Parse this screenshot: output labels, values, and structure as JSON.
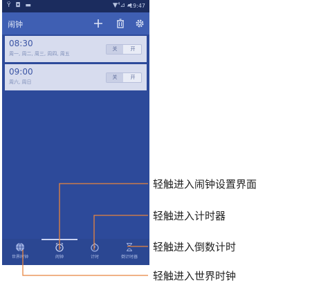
{
  "status_bar": {
    "left_icons": "Ÿ ◘ ▬",
    "signal": "▼⁴⊿ ▰",
    "time": "19:47"
  },
  "app_bar": {
    "title": "闹钟",
    "icons": [
      "add-icon",
      "delete-icon",
      "settings-icon"
    ]
  },
  "alarms": [
    {
      "time": "08:30",
      "days": "周一, 周二, 周三, 周四, 周五",
      "toggle_off": "关",
      "toggle_on": "开"
    },
    {
      "time": "09:00",
      "days": "周六, 周日",
      "toggle_off": "关",
      "toggle_on": "开"
    }
  ],
  "tabs": [
    {
      "label": "世界时钟",
      "icon": "globe-icon"
    },
    {
      "label": "闹钟",
      "icon": "alarm-clock-icon"
    },
    {
      "label": "计时",
      "icon": "stopwatch-icon"
    },
    {
      "label": "倒计时器",
      "icon": "hourglass-icon"
    }
  ],
  "callouts": [
    "轻触进入闹钟设置界面",
    "轻触进入计时器",
    "轻触进入倒数计时",
    "轻触进入世界时钟"
  ],
  "colors": {
    "primary": "#2d4a9a",
    "appbar": "#3f5fb3",
    "list_item": "#d7dcee",
    "callout_line": "#e8853f"
  }
}
